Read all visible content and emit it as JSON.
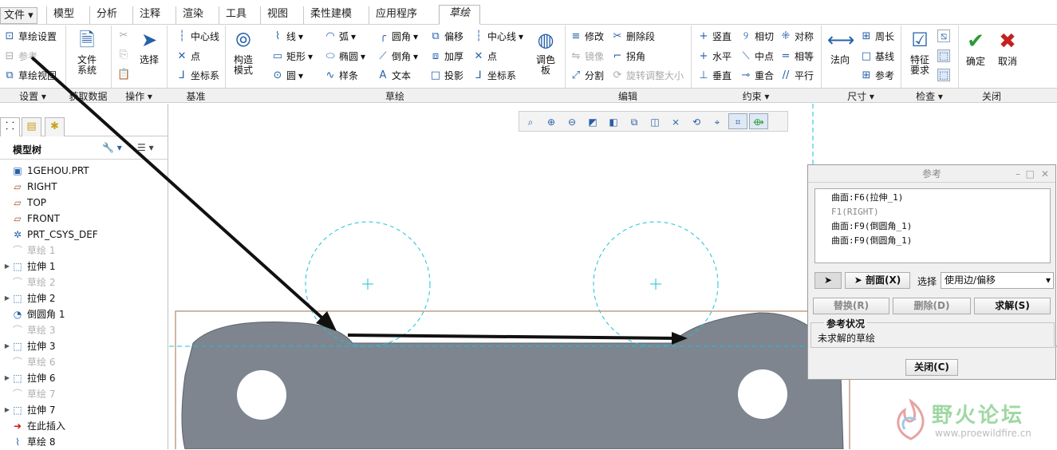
{
  "menu": {
    "file": "文件",
    "tabs": [
      "模型",
      "分析",
      "注释",
      "渲染",
      "工具",
      "视图",
      "柔性建模",
      "应用程序"
    ],
    "active_tab": "草绘"
  },
  "ribbon": {
    "setup": {
      "items": [
        "草绘设置",
        "参考",
        "草绘视图"
      ],
      "label": "设置"
    },
    "get_data": {
      "big": "文件系统",
      "label": "获取数据"
    },
    "operations": {
      "big": "选择",
      "label": "操作"
    },
    "datum": {
      "items": [
        "中心线",
        "点",
        "坐标系"
      ],
      "label": "基准"
    },
    "sketch": {
      "construction_mode": "构造模式",
      "col1": [
        "线",
        "矩形",
        "圆"
      ],
      "col2": [
        "弧",
        "椭圆",
        "样条"
      ],
      "col3": [
        "圆角",
        "倒角",
        "文本"
      ],
      "col4": [
        "偏移",
        "加厚",
        "投影"
      ],
      "col5": [
        "中心线",
        "点",
        "坐标系"
      ],
      "palette": "调色板",
      "label": "草绘"
    },
    "editing": {
      "items": [
        "修改",
        "删除段",
        "镜像",
        "拐角",
        "分割",
        "旋转调整大小"
      ],
      "label": "编辑"
    },
    "constrain": {
      "items": [
        "竖直",
        "相切",
        "对称",
        "水平",
        "中点",
        "相等",
        "垂直",
        "重合",
        "平行"
      ],
      "label": "约束"
    },
    "dimension": {
      "big": "法向",
      "items": [
        "周长",
        "基线",
        "参考"
      ],
      "label": "尺寸"
    },
    "inspect": {
      "big": "特征要求",
      "label": "检查"
    },
    "close": {
      "ok": "确定",
      "cancel": "取消",
      "label": "关闭"
    }
  },
  "model_tree": {
    "title": "模型树",
    "items": [
      {
        "label": "1GEHOU.PRT",
        "icon": "part-icon",
        "dim": false,
        "expand": false
      },
      {
        "label": "RIGHT",
        "icon": "datum-plane-icon",
        "dim": false,
        "expand": false
      },
      {
        "label": "TOP",
        "icon": "datum-plane-icon",
        "dim": false,
        "expand": false
      },
      {
        "label": "FRONT",
        "icon": "datum-plane-icon",
        "dim": false,
        "expand": false
      },
      {
        "label": "PRT_CSYS_DEF",
        "icon": "csys-icon",
        "dim": false,
        "expand": false
      },
      {
        "label": "草绘 1",
        "icon": "sketch-icon",
        "dim": true,
        "expand": false
      },
      {
        "label": "拉伸 1",
        "icon": "extrude-icon",
        "dim": false,
        "expand": true
      },
      {
        "label": "草绘 2",
        "icon": "sketch-icon",
        "dim": true,
        "expand": false
      },
      {
        "label": "拉伸 2",
        "icon": "extrude-icon",
        "dim": false,
        "expand": true
      },
      {
        "label": "倒圆角 1",
        "icon": "round-icon",
        "dim": false,
        "expand": false
      },
      {
        "label": "草绘 3",
        "icon": "sketch-icon",
        "dim": true,
        "expand": false
      },
      {
        "label": "拉伸 3",
        "icon": "extrude-icon",
        "dim": false,
        "expand": true
      },
      {
        "label": "草绘 6",
        "icon": "sketch-icon",
        "dim": true,
        "expand": false
      },
      {
        "label": "拉伸 6",
        "icon": "extrude-icon",
        "dim": false,
        "expand": true
      },
      {
        "label": "草绘 7",
        "icon": "sketch-icon",
        "dim": true,
        "expand": false
      },
      {
        "label": "拉伸 7",
        "icon": "extrude-icon",
        "dim": false,
        "expand": true
      },
      {
        "label": "在此插入",
        "icon": "insert-here-icon",
        "dim": false,
        "expand": false
      },
      {
        "label": "草绘 8",
        "icon": "sketch-active-icon",
        "dim": false,
        "expand": false
      }
    ]
  },
  "ref_dialog": {
    "title": "参考",
    "refs": [
      "曲面:F6(拉伸_1)",
      "F1(RIGHT)",
      "曲面:F9(倒圆角_1)",
      "曲面:F9(倒圆角_1)"
    ],
    "section_button": "剖面(X)",
    "select_label": "选择",
    "select_value": "使用边/偏移",
    "replace": "替换(R)",
    "delete": "删除(D)",
    "solve": "求解(S)",
    "status_title": "参考状况",
    "status_text": "未求解的草绘",
    "close": "关闭(C)"
  },
  "watermark": {
    "name": "野火论坛",
    "url": "www.proewildfire.cn"
  },
  "colors": {
    "accent": "#2561a8",
    "part": "#7e858f",
    "construction": "#19c3d6"
  }
}
